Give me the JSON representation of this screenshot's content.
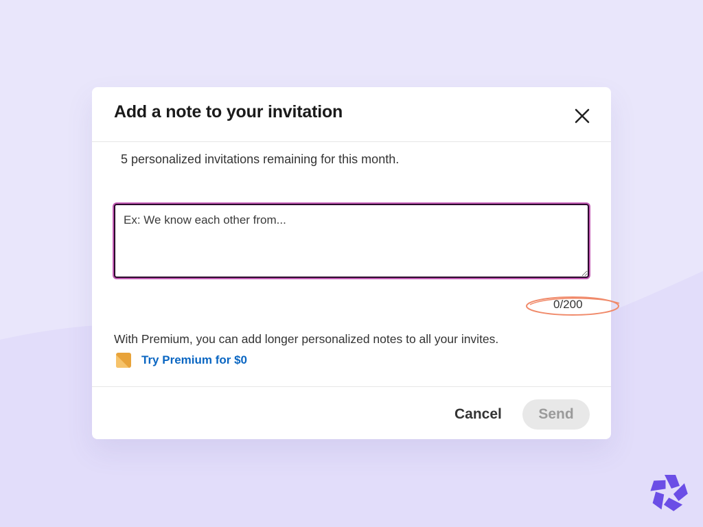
{
  "modal": {
    "title": "Add a note to your invitation",
    "remaining_text": "5 personalized invitations remaining for this month.",
    "textarea": {
      "placeholder": "Ex: We know each other from...",
      "value": ""
    },
    "char_counter": "0/200",
    "premium": {
      "description": "With Premium, you can add longer personalized notes to all your invites.",
      "link_label": "Try Premium for $0",
      "badge_icon": "premium-badge-icon"
    },
    "footer": {
      "cancel_label": "Cancel",
      "send_label": "Send",
      "send_enabled": false
    }
  },
  "icons": {
    "close": "close-icon",
    "brand": "brand-logo-icon"
  },
  "colors": {
    "background": "#e9e6fb",
    "link": "#0a66c2",
    "focus_ring": "#c35bb5",
    "annotation": "#f08a6a",
    "brand": "#6b4ee6",
    "premium_badge": "#e8a33a"
  }
}
